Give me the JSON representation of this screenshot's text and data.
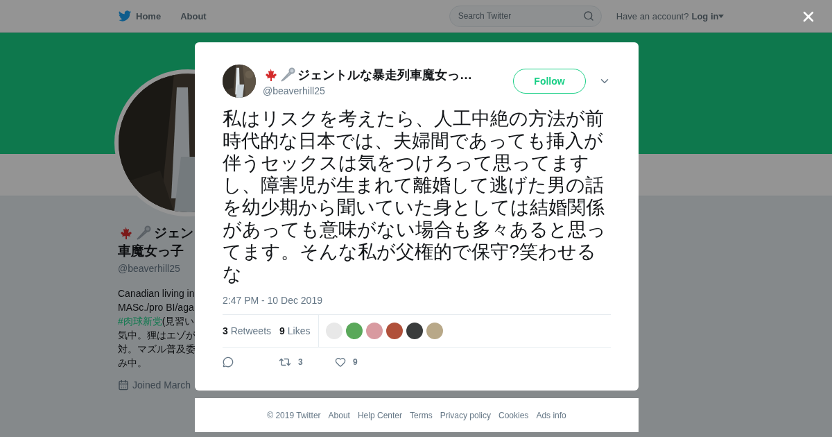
{
  "header": {
    "nav": [
      "Home",
      "About"
    ],
    "search": {
      "placeholder": "Search Twitter"
    },
    "account_prompt": "Have an account?",
    "login": "Log in"
  },
  "profile": {
    "name_lines": [
      "ジェン",
      "車魔女っ子"
    ],
    "handle": "@beaverhill25",
    "bio_lines": [
      {
        "text": "Canadian living in"
      },
      {
        "text": "MASc./pro BI/aga"
      },
      {
        "link": "#肉球新党",
        "text": "(見習い"
      },
      {
        "text": "気中。狸はエゾが"
      },
      {
        "text": "対。マズル普及委"
      },
      {
        "text": "み中。"
      }
    ],
    "joined": "Joined March"
  },
  "tweet": {
    "display_name": "ジェントルな暴走列車魔女っ…",
    "handle": "@beaverhill25",
    "follow": "Follow",
    "text": "私はリスクを考えたら、人工中絶の方法が前時代的な日本では、夫婦間であっても挿入が伴うセックスは気をつけろって思ってますし、障害児が生まれて離婚して逃げた男の話を幼少期から聞いていた身としては結婚関係があっても意味がない場合も多々あると思ってます。そんな私が父権的で保守?笑わせるな",
    "time": "2:47 PM - 10 Dec 2019",
    "stats": [
      {
        "count": "3",
        "label": "Retweets"
      },
      {
        "count": "9",
        "label": "Likes"
      }
    ],
    "likers": [
      {
        "color": "#e8e8e8"
      },
      {
        "color": "#5aa85a"
      },
      {
        "color": "#d89aa0"
      },
      {
        "color": "#b0503a"
      },
      {
        "color": "#3a3c3c"
      },
      {
        "color": "#b8a888"
      }
    ],
    "actions": [
      {
        "kind": "reply"
      },
      {
        "kind": "retweet",
        "count": "3"
      },
      {
        "kind": "like",
        "count": "9"
      }
    ]
  },
  "footer": [
    "© 2019 Twitter",
    "About",
    "Help Center",
    "Terms",
    "Privacy policy",
    "Cookies",
    "Ads info"
  ]
}
